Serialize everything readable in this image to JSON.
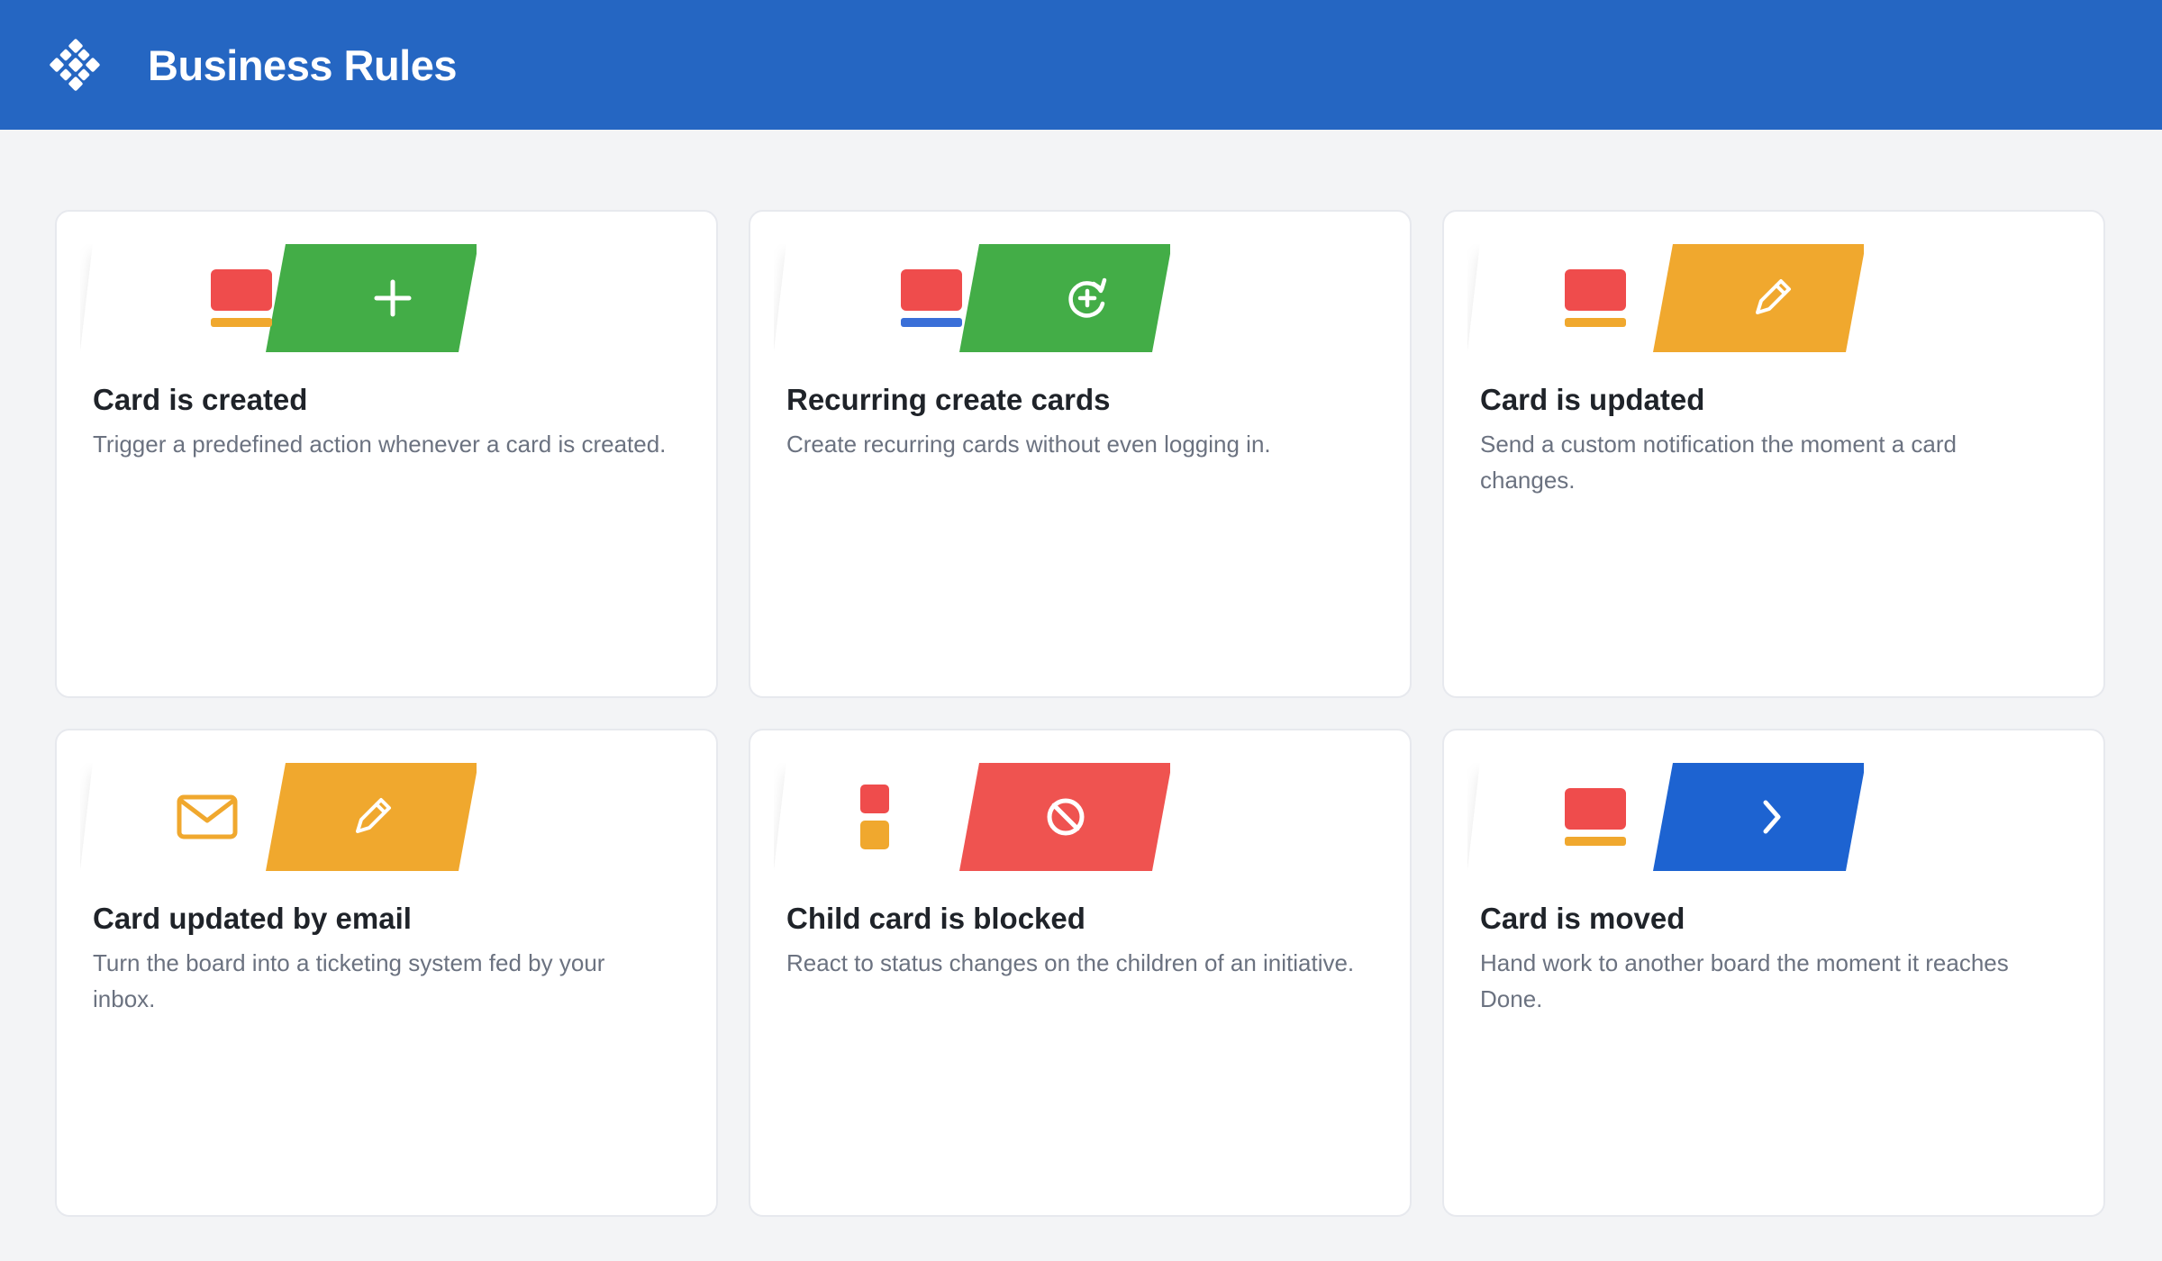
{
  "header": {
    "title": "Business Rules",
    "logo_icon": "diamond-grid-icon"
  },
  "colors": {
    "header_bg": "#2566c2",
    "green": "#43ad47",
    "amber": "#f0a82e",
    "red": "#ef5350",
    "blue": "#1d63d1",
    "card_icon_red": "#ef4c4c",
    "bar_amber": "#f0a82e",
    "bar_blue": "#3a6fd8"
  },
  "rules": [
    {
      "title": "Card is created",
      "description": "Trigger a predefined action whenever a card is created.",
      "left_icon": "card-amber-icon",
      "right_icon": "plus-icon",
      "accent": "green"
    },
    {
      "title": "Recurring create cards",
      "description": "Create recurring cards without even logging in.",
      "left_icon": "card-blue-icon",
      "right_icon": "recurring-add-icon",
      "accent": "green"
    },
    {
      "title": "Card is updated",
      "description": "Send a custom notification the moment a card changes.",
      "left_icon": "card-amber-icon",
      "right_icon": "pencil-icon",
      "accent": "amber"
    },
    {
      "title": "Card updated by email",
      "description": "Turn the board into a ticketing system fed by your inbox.",
      "left_icon": "envelope-icon",
      "right_icon": "pencil-icon",
      "accent": "amber"
    },
    {
      "title": "Child card is blocked",
      "description": "React to status changes on the children of an initiative.",
      "left_icon": "child-cards-icon",
      "right_icon": "blocked-icon",
      "accent": "red"
    },
    {
      "title": "Card is moved",
      "description": "Hand work to another board the moment it reaches Done.",
      "left_icon": "card-amber-icon",
      "right_icon": "chevron-right-icon",
      "accent": "blue"
    }
  ]
}
